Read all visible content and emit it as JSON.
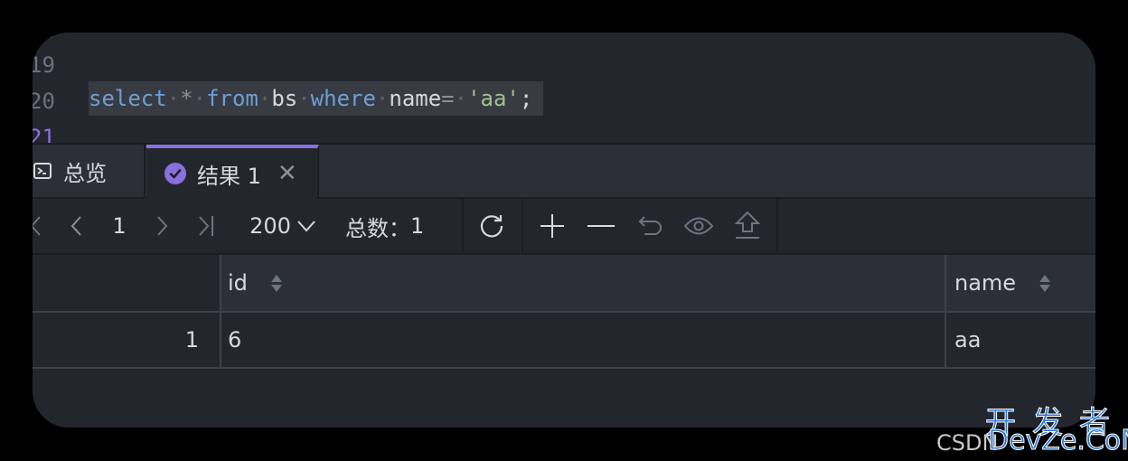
{
  "editor": {
    "lines": [
      {
        "number": "19",
        "active": false
      },
      {
        "number": "20",
        "active": false
      },
      {
        "number": "21",
        "active": true
      }
    ],
    "query": {
      "kw_select": "select",
      "star": "*",
      "kw_from": "from",
      "table": "bs",
      "kw_where": "where",
      "column": "name",
      "eq": "=",
      "value": "'aa'",
      "semi": ";"
    }
  },
  "tabs": [
    {
      "label": "总览",
      "icon": "console-icon",
      "active": false
    },
    {
      "label": "结果 1",
      "icon": "check-circle-icon",
      "active": true,
      "closable": true
    }
  ],
  "toolbar": {
    "page": "1",
    "page_size": "200",
    "total_label": "总数：",
    "total": "1",
    "icons": [
      "first-page-icon",
      "prev-page-icon",
      "next-page-icon",
      "last-page-icon",
      "refresh-icon",
      "add-row-icon",
      "delete-row-icon",
      "undo-icon",
      "preview-icon",
      "commit-icon"
    ]
  },
  "grid": {
    "columns": [
      "id",
      "name"
    ],
    "rows": [
      {
        "rownum": "1",
        "cells": [
          "6",
          "aa"
        ]
      }
    ]
  },
  "watermark": {
    "cn": "开发者",
    "en": "DevZe.CoM",
    "bg": "CSDN"
  },
  "colors": {
    "accent": "#8a6fdf",
    "keyword": "#6d9fd8",
    "string": "#a3c28b",
    "background": "#23262d"
  }
}
